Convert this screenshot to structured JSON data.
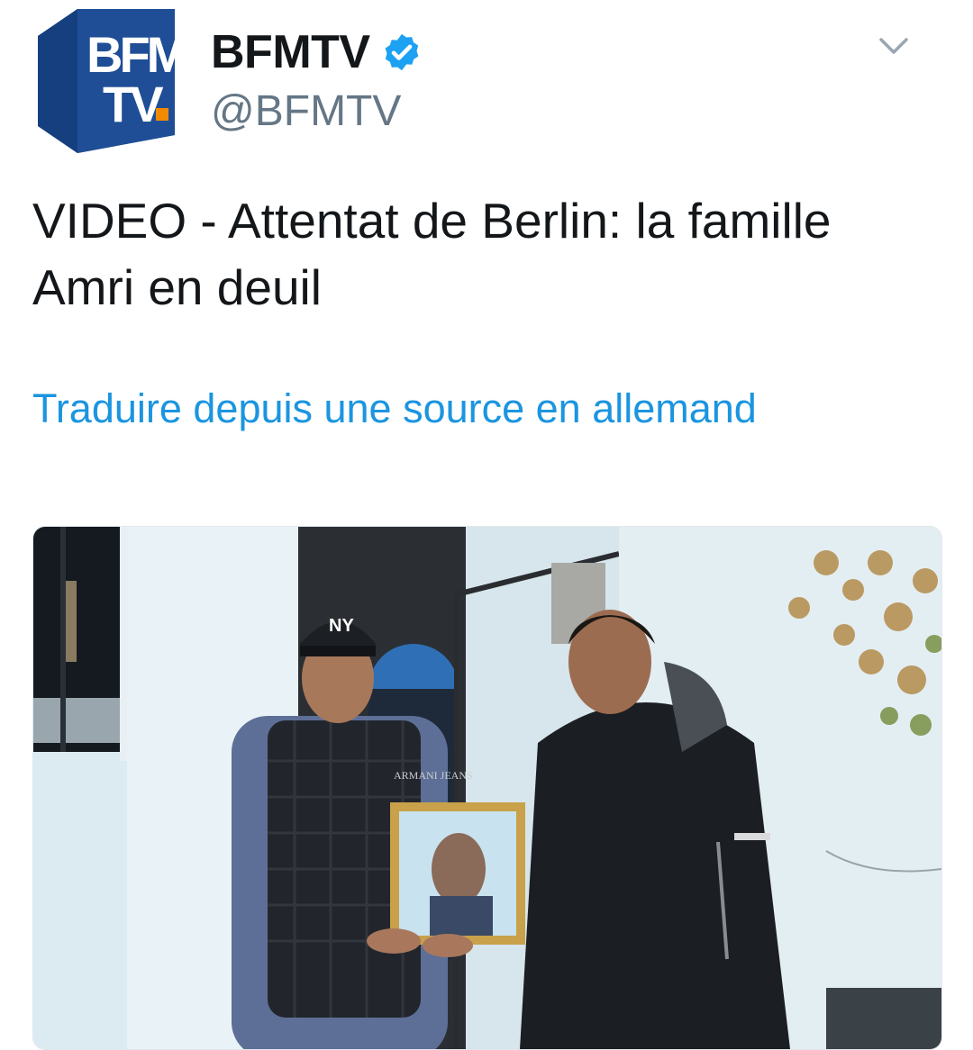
{
  "account": {
    "logo_text_line1": "BFM",
    "logo_text_line2": "TV.",
    "display_name": "BFMTV",
    "handle": "@BFMTV",
    "verified": true,
    "logo_color": "#1f4e96",
    "verified_color": "#1da1f2"
  },
  "tweet": {
    "text": "VIDEO - Attentat de Berlin: la famille Amri en deuil",
    "translate_label": "Traduire depuis une source en allemand",
    "link_color": "#1b95e0"
  },
  "media": {
    "type": "video-thumbnail",
    "cap_text": "NY",
    "jacket_text": "ARMANI JEANS"
  },
  "icons": {
    "menu": "chevron-down-icon",
    "verified": "verified-badge-icon"
  }
}
